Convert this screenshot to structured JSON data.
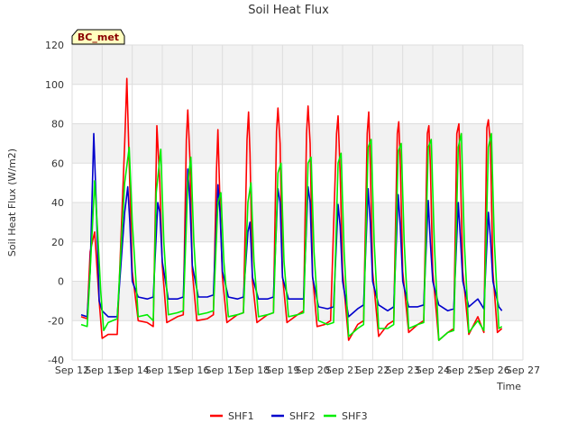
{
  "chart_data": {
    "type": "line",
    "title": "Soil Heat Flux",
    "xlabel": "Time",
    "ylabel": "Soil Heat Flux (W/m2)",
    "station_badge": "BC_met",
    "ylim": [
      -40,
      120
    ],
    "yticks": [
      -40,
      -20,
      0,
      20,
      40,
      60,
      80,
      100,
      120
    ],
    "xlim": [
      12,
      27
    ],
    "xticks": [
      {
        "x": 12,
        "label": "Sep 12"
      },
      {
        "x": 13,
        "label": "Sep 13"
      },
      {
        "x": 14,
        "label": "Sep 14"
      },
      {
        "x": 15,
        "label": "Sep 15"
      },
      {
        "x": 16,
        "label": "Sep 16"
      },
      {
        "x": 17,
        "label": "Sep 17"
      },
      {
        "x": 18,
        "label": "Sep 18"
      },
      {
        "x": 19,
        "label": "Sep 19"
      },
      {
        "x": 20,
        "label": "Sep 20"
      },
      {
        "x": 21,
        "label": "Sep 21"
      },
      {
        "x": 22,
        "label": "Sep 22"
      },
      {
        "x": 23,
        "label": "Sep 23"
      },
      {
        "x": 24,
        "label": "Sep 24"
      },
      {
        "x": 25,
        "label": "Sep 25"
      },
      {
        "x": 26,
        "label": "Sep 26"
      },
      {
        "x": 27,
        "label": "Sep 27"
      }
    ],
    "grid": true,
    "legend_position": "bottom",
    "series": [
      {
        "name": "SHF1",
        "color": "#ff0000",
        "points": [
          [
            12.3,
            -18
          ],
          [
            12.5,
            -19
          ],
          [
            12.6,
            15
          ],
          [
            12.75,
            25
          ],
          [
            12.9,
            -10
          ],
          [
            13.0,
            -29
          ],
          [
            13.2,
            -27
          ],
          [
            13.5,
            -27
          ],
          [
            13.75,
            70
          ],
          [
            13.82,
            103
          ],
          [
            13.9,
            60
          ],
          [
            14.0,
            5
          ],
          [
            14.2,
            -20
          ],
          [
            14.5,
            -21
          ],
          [
            14.7,
            -23
          ],
          [
            14.82,
            79
          ],
          [
            14.92,
            50
          ],
          [
            15.0,
            8
          ],
          [
            15.15,
            -21
          ],
          [
            15.5,
            -18
          ],
          [
            15.7,
            -17
          ],
          [
            15.8,
            72
          ],
          [
            15.85,
            87
          ],
          [
            15.92,
            62
          ],
          [
            16.0,
            5
          ],
          [
            16.15,
            -20
          ],
          [
            16.5,
            -19
          ],
          [
            16.7,
            -17
          ],
          [
            16.8,
            55
          ],
          [
            16.85,
            77
          ],
          [
            16.92,
            40
          ],
          [
            17.0,
            2
          ],
          [
            17.15,
            -21
          ],
          [
            17.5,
            -17
          ],
          [
            17.7,
            -16
          ],
          [
            17.82,
            72
          ],
          [
            17.87,
            86
          ],
          [
            17.92,
            65
          ],
          [
            18.0,
            0
          ],
          [
            18.15,
            -21
          ],
          [
            18.5,
            -17
          ],
          [
            18.7,
            -16
          ],
          [
            18.8,
            76
          ],
          [
            18.85,
            88
          ],
          [
            18.92,
            70
          ],
          [
            19.0,
            3
          ],
          [
            19.15,
            -21
          ],
          [
            19.5,
            -17
          ],
          [
            19.7,
            -15
          ],
          [
            19.8,
            75
          ],
          [
            19.85,
            89
          ],
          [
            19.92,
            70
          ],
          [
            20.0,
            3
          ],
          [
            20.15,
            -23
          ],
          [
            20.4,
            -22
          ],
          [
            20.6,
            -20
          ],
          [
            20.8,
            75
          ],
          [
            20.85,
            84
          ],
          [
            20.92,
            55
          ],
          [
            21.0,
            5
          ],
          [
            21.2,
            -30
          ],
          [
            21.5,
            -22
          ],
          [
            21.7,
            -20
          ],
          [
            21.82,
            75
          ],
          [
            21.87,
            86
          ],
          [
            21.92,
            60
          ],
          [
            22.0,
            5
          ],
          [
            22.2,
            -28
          ],
          [
            22.5,
            -22
          ],
          [
            22.7,
            -20
          ],
          [
            22.82,
            75
          ],
          [
            22.87,
            81
          ],
          [
            22.92,
            60
          ],
          [
            23.0,
            5
          ],
          [
            23.2,
            -26
          ],
          [
            23.5,
            -22
          ],
          [
            23.7,
            -20
          ],
          [
            23.82,
            75
          ],
          [
            23.87,
            79
          ],
          [
            23.92,
            60
          ],
          [
            24.0,
            5
          ],
          [
            24.2,
            -30
          ],
          [
            24.5,
            -26
          ],
          [
            24.7,
            -24
          ],
          [
            24.8,
            75
          ],
          [
            24.87,
            80
          ],
          [
            24.92,
            55
          ],
          [
            25.0,
            5
          ],
          [
            25.2,
            -27
          ],
          [
            25.5,
            -18
          ],
          [
            25.7,
            -26
          ],
          [
            25.8,
            78
          ],
          [
            25.85,
            82
          ],
          [
            25.92,
            69
          ],
          [
            26.0,
            5
          ],
          [
            26.15,
            -26
          ],
          [
            26.3,
            -24
          ]
        ]
      },
      {
        "name": "SHF2",
        "color": "#0000cc",
        "points": [
          [
            12.3,
            -17
          ],
          [
            12.5,
            -18
          ],
          [
            12.6,
            5
          ],
          [
            12.72,
            75
          ],
          [
            12.8,
            40
          ],
          [
            12.9,
            -10
          ],
          [
            13.0,
            -15
          ],
          [
            13.2,
            -18
          ],
          [
            13.5,
            -18
          ],
          [
            13.75,
            35
          ],
          [
            13.85,
            48
          ],
          [
            13.92,
            30
          ],
          [
            14.0,
            0
          ],
          [
            14.2,
            -8
          ],
          [
            14.5,
            -9
          ],
          [
            14.7,
            -8
          ],
          [
            14.85,
            40
          ],
          [
            14.92,
            35
          ],
          [
            15.0,
            10
          ],
          [
            15.2,
            -9
          ],
          [
            15.5,
            -9
          ],
          [
            15.7,
            -8
          ],
          [
            15.85,
            57
          ],
          [
            15.92,
            40
          ],
          [
            16.0,
            8
          ],
          [
            16.2,
            -8
          ],
          [
            16.5,
            -8
          ],
          [
            16.7,
            -7
          ],
          [
            16.85,
            49
          ],
          [
            16.92,
            35
          ],
          [
            17.0,
            5
          ],
          [
            17.2,
            -8
          ],
          [
            17.5,
            -9
          ],
          [
            17.7,
            -8
          ],
          [
            17.85,
            25
          ],
          [
            17.92,
            30
          ],
          [
            18.0,
            2
          ],
          [
            18.2,
            -9
          ],
          [
            18.5,
            -9
          ],
          [
            18.7,
            -8
          ],
          [
            18.85,
            47
          ],
          [
            18.92,
            40
          ],
          [
            19.0,
            2
          ],
          [
            19.2,
            -9
          ],
          [
            19.5,
            -9
          ],
          [
            19.7,
            -9
          ],
          [
            19.85,
            48
          ],
          [
            19.92,
            40
          ],
          [
            20.0,
            2
          ],
          [
            20.2,
            -13
          ],
          [
            20.5,
            -14
          ],
          [
            20.7,
            -13
          ],
          [
            20.85,
            39
          ],
          [
            20.92,
            28
          ],
          [
            21.0,
            0
          ],
          [
            21.2,
            -18
          ],
          [
            21.5,
            -14
          ],
          [
            21.7,
            -12
          ],
          [
            21.85,
            47
          ],
          [
            21.92,
            30
          ],
          [
            22.0,
            0
          ],
          [
            22.2,
            -12
          ],
          [
            22.5,
            -15
          ],
          [
            22.7,
            -13
          ],
          [
            22.85,
            44
          ],
          [
            22.92,
            28
          ],
          [
            23.0,
            0
          ],
          [
            23.2,
            -13
          ],
          [
            23.5,
            -13
          ],
          [
            23.7,
            -12
          ],
          [
            23.85,
            41
          ],
          [
            23.92,
            20
          ],
          [
            24.0,
            0
          ],
          [
            24.2,
            -12
          ],
          [
            24.5,
            -15
          ],
          [
            24.7,
            -14
          ],
          [
            24.85,
            40
          ],
          [
            24.92,
            22
          ],
          [
            25.0,
            0
          ],
          [
            25.2,
            -13
          ],
          [
            25.5,
            -9
          ],
          [
            25.7,
            -14
          ],
          [
            25.85,
            35
          ],
          [
            25.92,
            22
          ],
          [
            26.0,
            0
          ],
          [
            26.2,
            -13
          ],
          [
            26.3,
            -15
          ]
        ]
      },
      {
        "name": "SHF3",
        "color": "#00ee00",
        "points": [
          [
            12.3,
            -22
          ],
          [
            12.5,
            -23
          ],
          [
            12.6,
            5
          ],
          [
            12.75,
            51
          ],
          [
            12.85,
            25
          ],
          [
            12.95,
            -5
          ],
          [
            13.05,
            -25
          ],
          [
            13.2,
            -21
          ],
          [
            13.5,
            -19
          ],
          [
            13.75,
            50
          ],
          [
            13.9,
            68
          ],
          [
            14.0,
            30
          ],
          [
            14.2,
            -18
          ],
          [
            14.5,
            -17
          ],
          [
            14.7,
            -20
          ],
          [
            14.8,
            45
          ],
          [
            14.95,
            67
          ],
          [
            15.05,
            20
          ],
          [
            15.2,
            -17
          ],
          [
            15.5,
            -16
          ],
          [
            15.7,
            -15
          ],
          [
            15.85,
            50
          ],
          [
            15.95,
            63
          ],
          [
            16.05,
            20
          ],
          [
            16.2,
            -17
          ],
          [
            16.5,
            -16
          ],
          [
            16.7,
            -15
          ],
          [
            16.85,
            40
          ],
          [
            16.95,
            45
          ],
          [
            17.05,
            10
          ],
          [
            17.2,
            -18
          ],
          [
            17.5,
            -17
          ],
          [
            17.7,
            -16
          ],
          [
            17.85,
            40
          ],
          [
            17.95,
            50
          ],
          [
            18.05,
            10
          ],
          [
            18.2,
            -18
          ],
          [
            18.5,
            -17
          ],
          [
            18.7,
            -16
          ],
          [
            18.85,
            55
          ],
          [
            18.95,
            60
          ],
          [
            19.05,
            10
          ],
          [
            19.2,
            -18
          ],
          [
            19.5,
            -17
          ],
          [
            19.7,
            -16
          ],
          [
            19.85,
            60
          ],
          [
            19.95,
            63
          ],
          [
            20.05,
            15
          ],
          [
            20.2,
            -20
          ],
          [
            20.5,
            -22
          ],
          [
            20.7,
            -21
          ],
          [
            20.85,
            60
          ],
          [
            20.95,
            65
          ],
          [
            21.05,
            15
          ],
          [
            21.2,
            -28
          ],
          [
            21.5,
            -24
          ],
          [
            21.7,
            -22
          ],
          [
            21.85,
            68
          ],
          [
            21.95,
            72
          ],
          [
            22.05,
            20
          ],
          [
            22.2,
            -24
          ],
          [
            22.5,
            -24
          ],
          [
            22.7,
            -22
          ],
          [
            22.85,
            66
          ],
          [
            22.95,
            70
          ],
          [
            23.05,
            20
          ],
          [
            23.2,
            -24
          ],
          [
            23.5,
            -22
          ],
          [
            23.7,
            -21
          ],
          [
            23.85,
            68
          ],
          [
            23.95,
            72
          ],
          [
            24.05,
            20
          ],
          [
            24.2,
            -30
          ],
          [
            24.5,
            -26
          ],
          [
            24.7,
            -25
          ],
          [
            24.85,
            68
          ],
          [
            24.95,
            75
          ],
          [
            25.05,
            20
          ],
          [
            25.2,
            -26
          ],
          [
            25.5,
            -20
          ],
          [
            25.7,
            -25
          ],
          [
            25.85,
            68
          ],
          [
            25.95,
            75
          ],
          [
            26.05,
            20
          ],
          [
            26.2,
            -24
          ],
          [
            26.3,
            -23
          ]
        ]
      }
    ]
  }
}
